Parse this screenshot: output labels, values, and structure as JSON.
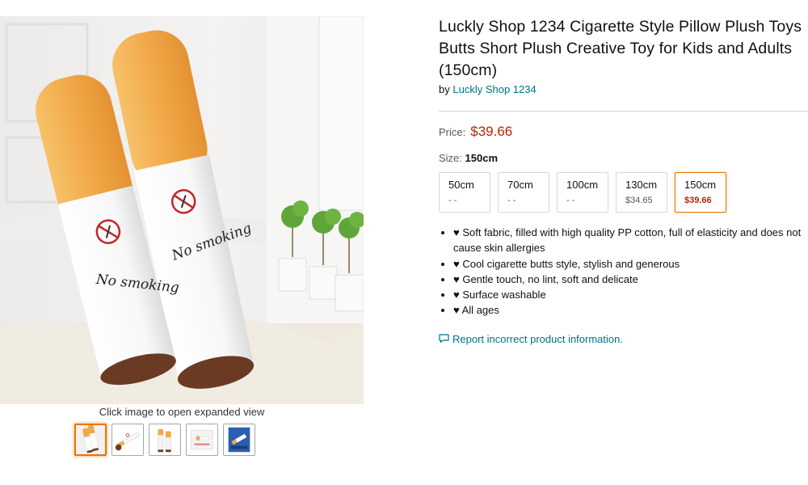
{
  "product": {
    "title": "Luckly Shop 1234 Cigarette Style Pillow Plush Toys Butts Short Plush Creative Toy for Kids and Adults (150cm)",
    "by_prefix": "by",
    "brand": "Luckly Shop 1234"
  },
  "image": {
    "caption": "Click image to open expanded view",
    "text_front": "No smoking",
    "text_back": "No smoking",
    "thumbnails": [
      "main-photo",
      "two-pillows",
      "pillow-pair",
      "package",
      "blue-box"
    ]
  },
  "price": {
    "label": "Price:",
    "value": "$39.66"
  },
  "size": {
    "label": "Size:",
    "selected": "150cm",
    "options": [
      {
        "label": "50cm",
        "price": "- -"
      },
      {
        "label": "70cm",
        "price": "- -"
      },
      {
        "label": "100cm",
        "price": "- -"
      },
      {
        "label": "130cm",
        "price": "$34.65"
      },
      {
        "label": "150cm",
        "price": "$39.66"
      }
    ]
  },
  "bullets": [
    "♥ Soft fabric, filled with high quality PP cotton, full of elasticity and does not cause skin allergies",
    "♥ Cool cigarette butts style, stylish and generous",
    "♥ Gentle touch, no lint, soft and delicate",
    "♥ Surface washable",
    "♥ All ages"
  ],
  "report_link": "Report incorrect product information.",
  "colors": {
    "price": "#b12704",
    "link": "#007185",
    "selected_border": "#e77600",
    "filter_orange": "#f0a640",
    "ash_brown": "#6b3a22"
  }
}
